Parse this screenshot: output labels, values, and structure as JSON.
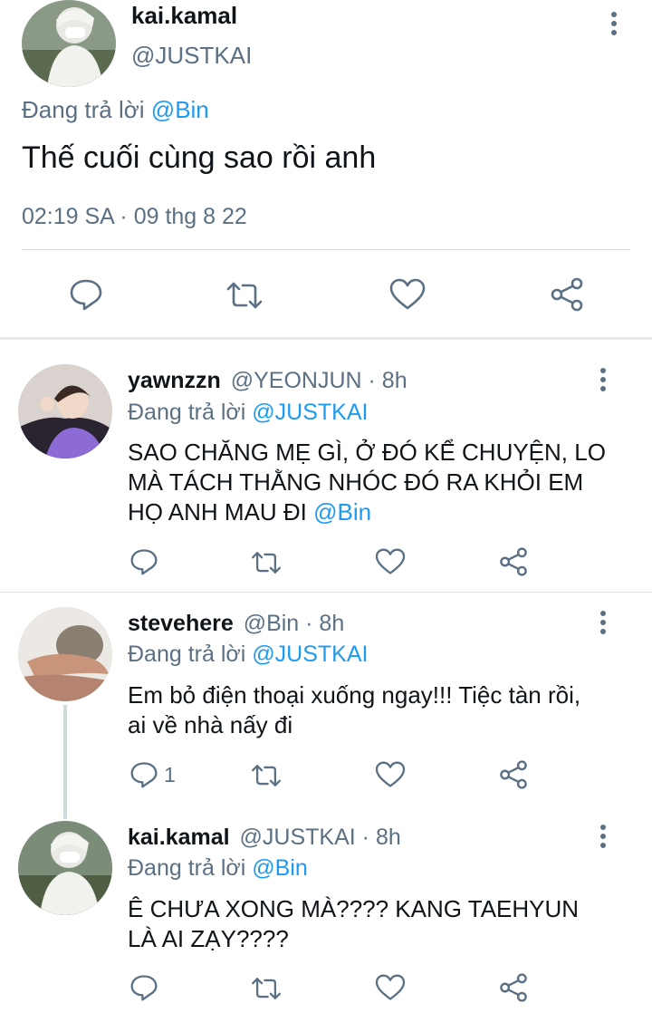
{
  "main_tweet": {
    "display_name": "kai.kamal",
    "handle": "@JUSTKAI",
    "replying_prefix": "Đang trả lời",
    "replying_to": "@Bin",
    "text": "Thế cuối cùng sao rồi anh",
    "timestamp": "02:19 SA · 09 thg 8 22",
    "actions": {
      "reply_icon": "reply-icon",
      "retweet_icon": "retweet-icon",
      "like_icon": "heart-icon",
      "share_icon": "share-icon"
    }
  },
  "replies": [
    {
      "display_name": "yawnzzn",
      "meta": "@YEONJUN · 8h",
      "replying_prefix": "Đang trả lời",
      "replying_to": "@JUSTKAI",
      "text": "SAO CHĂNG MẸ GÌ, Ở ĐÓ KỂ CHUYỆN, LO MÀ TÁCH THẰNG NHÓC ĐÓ RA KHỎI EM HỌ ANH MAU ĐI",
      "mention": "@Bin",
      "reply_count": ""
    },
    {
      "display_name": "stevehere",
      "meta": "@Bin · 8h",
      "replying_prefix": "Đang trả lời",
      "replying_to": "@JUSTKAI",
      "text": "Em bỏ điện thoại xuống ngay!!! Tiệc tàn rồi, ai về nhà nấy đi",
      "mention": "",
      "reply_count": "1"
    },
    {
      "display_name": "kai.kamal",
      "meta": "@JUSTKAI · 8h",
      "replying_prefix": "Đang trả lời",
      "replying_to": "@Bin",
      "text": "Ê CHƯA XONG MÀ???? KANG TAEHYUN LÀ AI ZẠY????",
      "mention": "",
      "reply_count": ""
    }
  ],
  "colors": {
    "text": "#0f1419",
    "secondary": "#5b7083",
    "accent": "#1d9bf0",
    "divider": "#dcdfe3"
  }
}
